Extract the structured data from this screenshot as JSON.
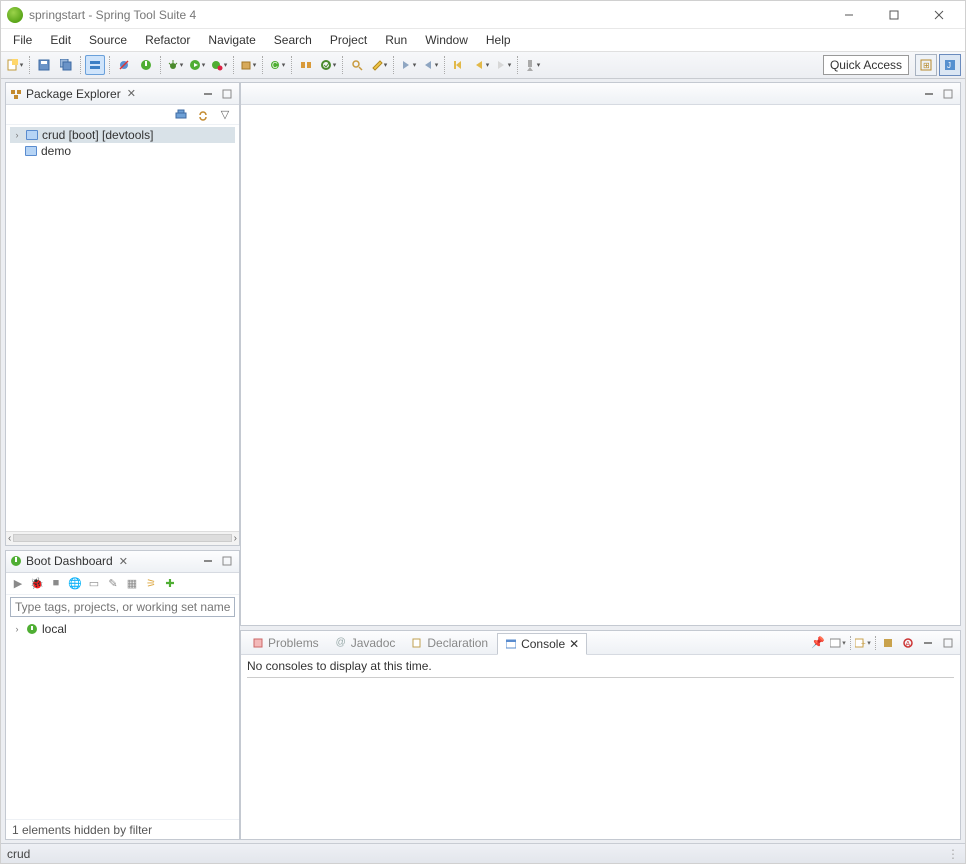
{
  "title": "springstart - Spring Tool Suite 4",
  "menu": [
    "File",
    "Edit",
    "Source",
    "Refactor",
    "Navigate",
    "Search",
    "Project",
    "Run",
    "Window",
    "Help"
  ],
  "quick_access": "Quick Access",
  "package_explorer": {
    "title": "Package Explorer",
    "items": [
      {
        "label": "crud [boot] [devtools]",
        "expandable": true,
        "selected": true,
        "icon": "project"
      },
      {
        "label": "demo",
        "expandable": false,
        "selected": false,
        "icon": "folder"
      }
    ]
  },
  "boot_dashboard": {
    "title": "Boot Dashboard",
    "filter_placeholder": "Type tags, projects, or working set names to match",
    "root": "local",
    "status": "1 elements hidden by filter"
  },
  "bottom_tabs": {
    "problems": "Problems",
    "javadoc": "Javadoc",
    "declaration": "Declaration",
    "console": "Console"
  },
  "console_message": "No consoles to display at this time.",
  "status_text": "crud"
}
